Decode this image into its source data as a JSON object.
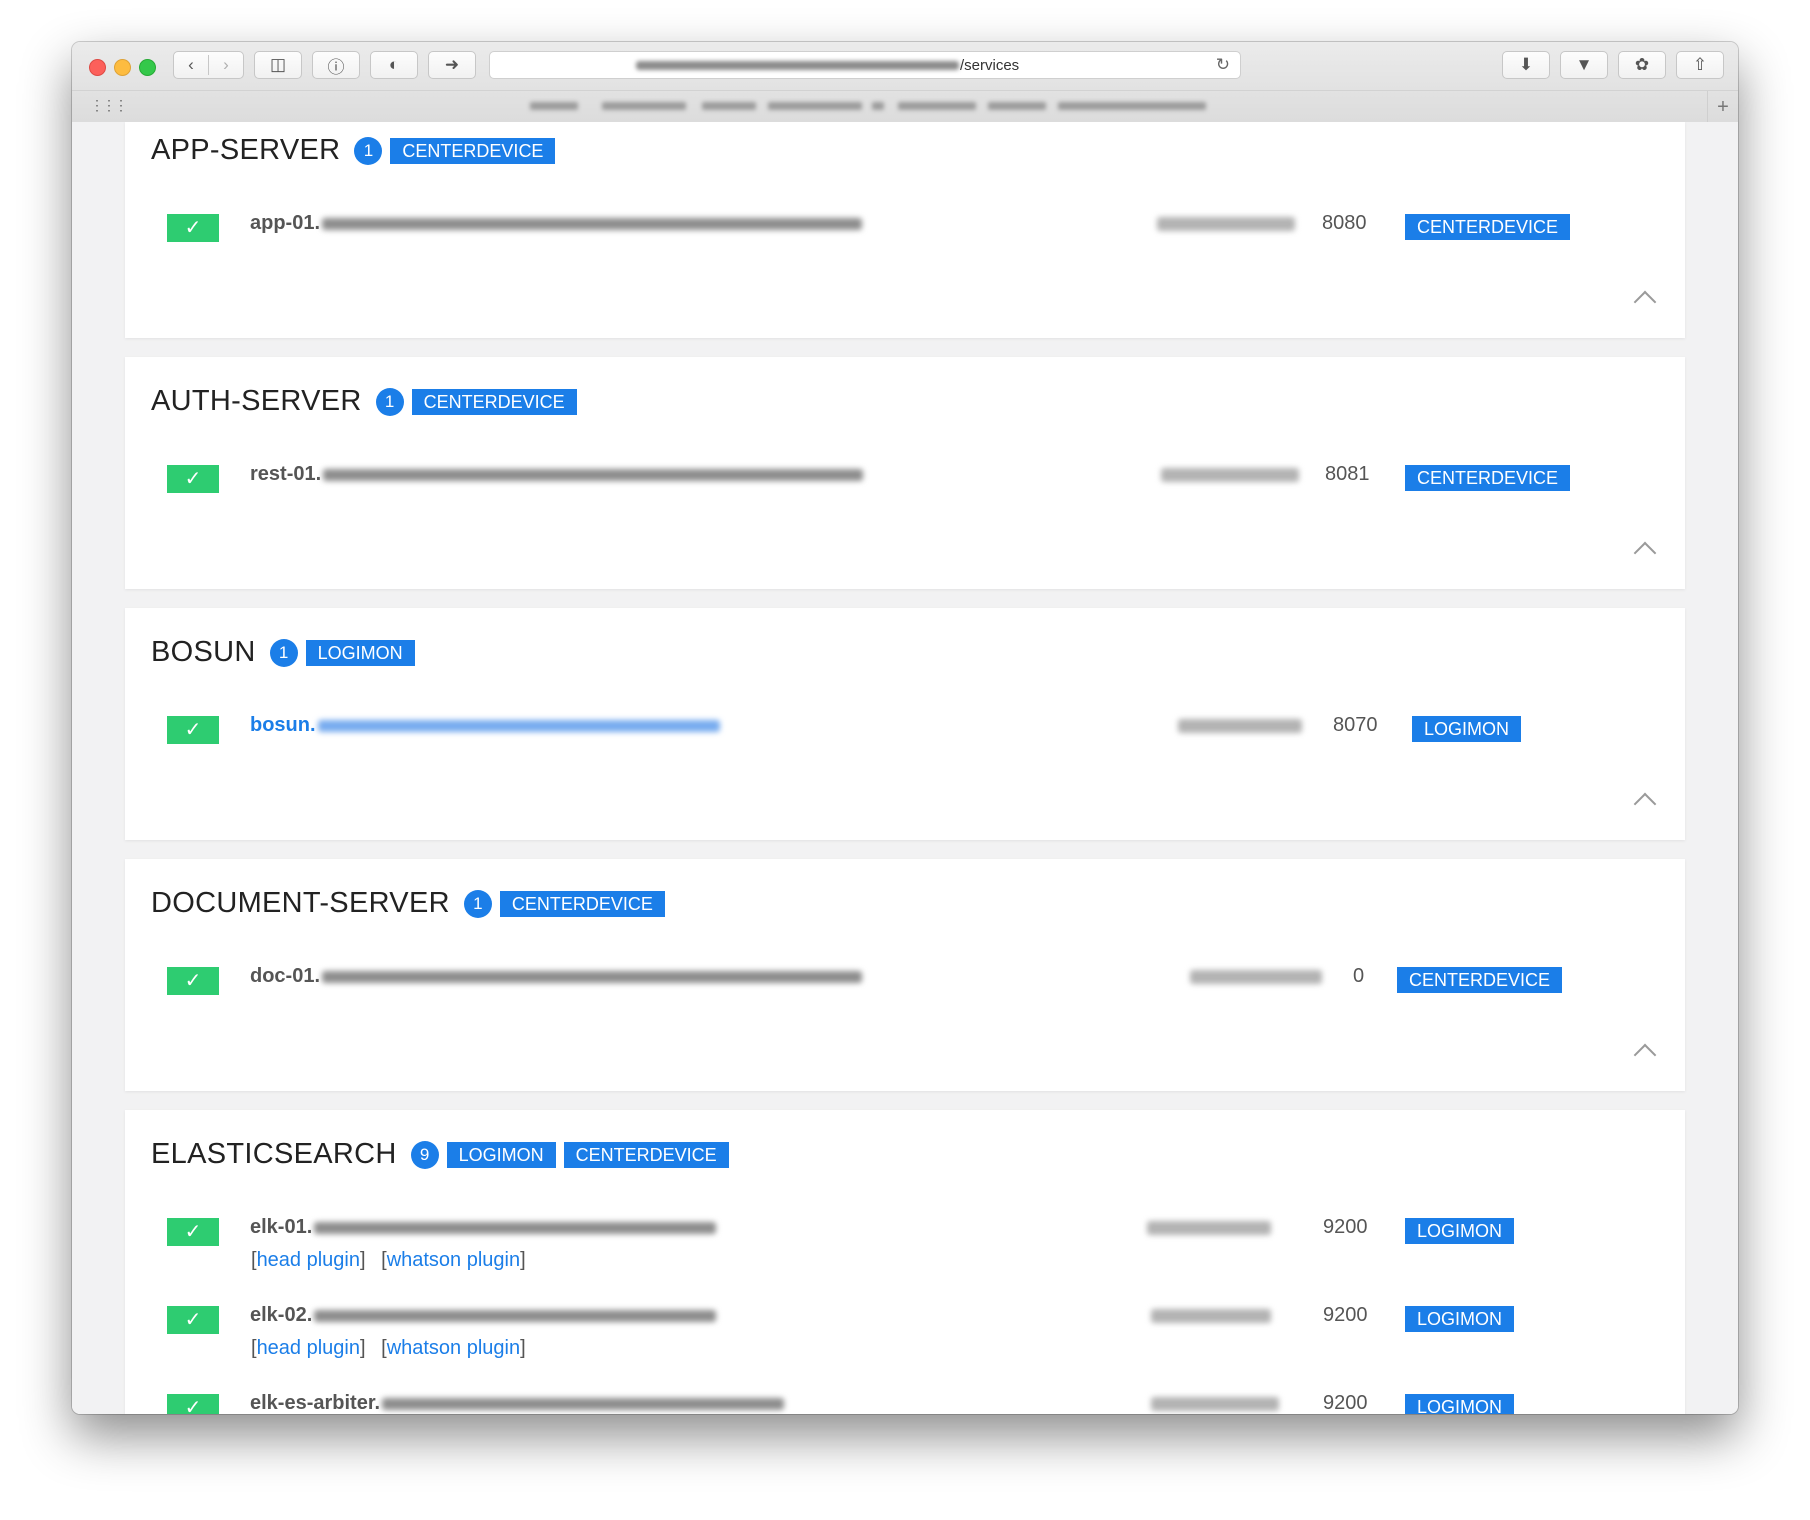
{
  "browser": {
    "url_visible": "/services",
    "toolbar_icons": [
      "back-icon",
      "forward-icon",
      "sidebar-icon",
      "info-icon",
      "toggle-icon",
      "arrow-right-icon",
      "download-icon",
      "pocket-icon",
      "evernote-icon",
      "share-icon"
    ]
  },
  "colors": {
    "accent": "#1b7ee8",
    "success": "#2ecc71",
    "background": "#f2f2f3"
  },
  "services": [
    {
      "name": "APP-SERVER",
      "count": "1",
      "tags": [
        "CENTERDEVICE"
      ],
      "instances": [
        {
          "host": "app-01.",
          "port": "8080",
          "tag": "CENTERDEVICE",
          "link": false
        }
      ]
    },
    {
      "name": "AUTH-SERVER",
      "count": "1",
      "tags": [
        "CENTERDEVICE"
      ],
      "instances": [
        {
          "host": "rest-01.",
          "port": "8081",
          "tag": "CENTERDEVICE",
          "link": false
        }
      ]
    },
    {
      "name": "BOSUN",
      "count": "1",
      "tags": [
        "LOGIMON"
      ],
      "instances": [
        {
          "host": "bosun.",
          "port": "8070",
          "tag": "LOGIMON",
          "link": true
        }
      ]
    },
    {
      "name": "DOCUMENT-SERVER",
      "count": "1",
      "tags": [
        "CENTERDEVICE"
      ],
      "instances": [
        {
          "host": "doc-01.",
          "port": "0",
          "tag": "CENTERDEVICE",
          "link": false
        }
      ]
    },
    {
      "name": "ELASTICSEARCH",
      "count": "9",
      "tags": [
        "LOGIMON",
        "CENTERDEVICE"
      ],
      "instances": [
        {
          "host": "elk-01.",
          "port": "9200",
          "tag": "LOGIMON",
          "link": false,
          "plugins": [
            "head plugin",
            "whatson plugin"
          ]
        },
        {
          "host": "elk-02.",
          "port": "9200",
          "tag": "LOGIMON",
          "link": false,
          "plugins": [
            "head plugin",
            "whatson plugin"
          ]
        },
        {
          "host": "elk-es-arbiter.",
          "port": "9200",
          "tag": "LOGIMON",
          "link": false
        }
      ]
    }
  ]
}
